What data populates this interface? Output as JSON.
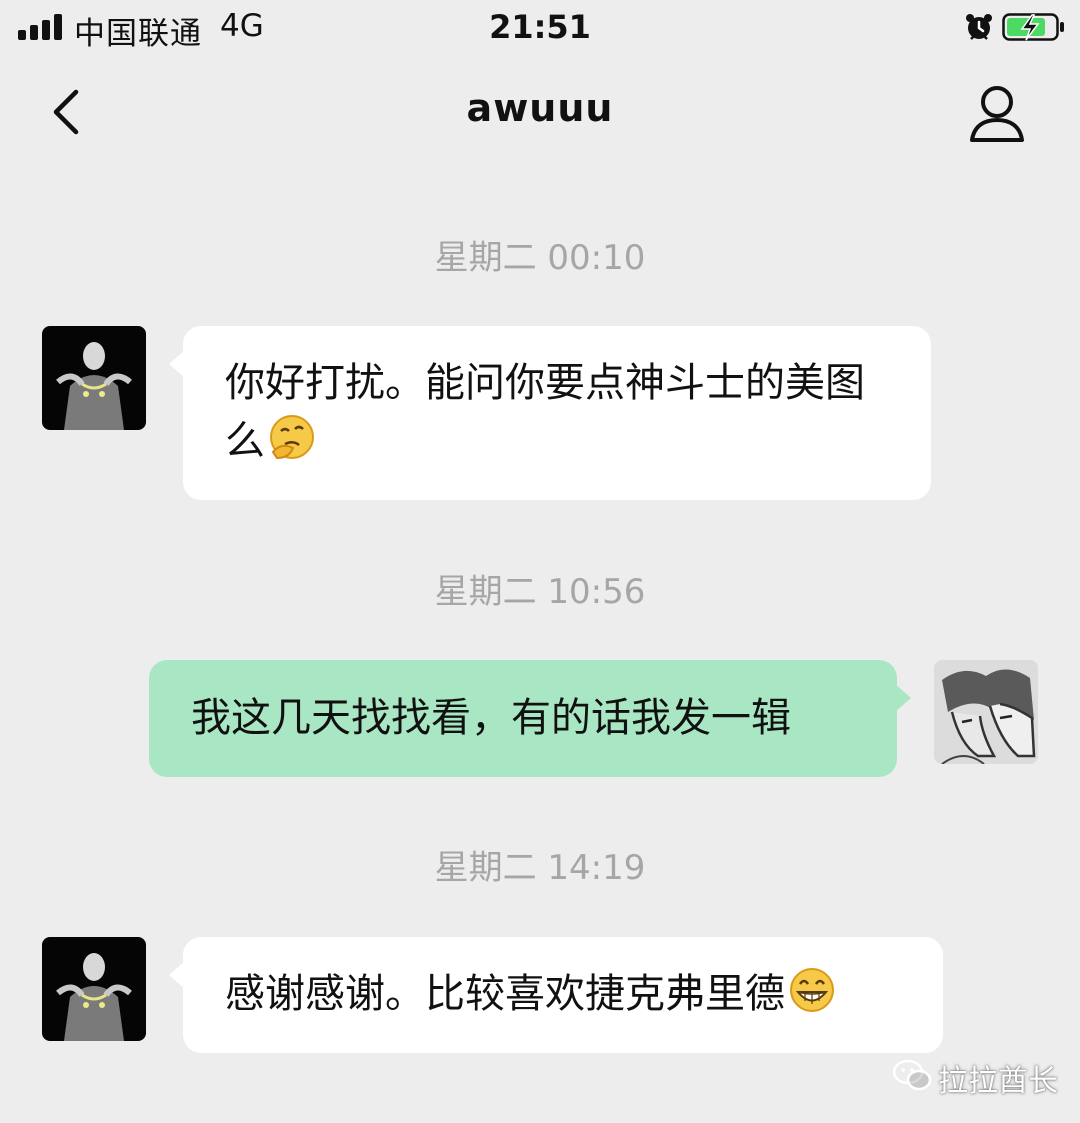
{
  "status_bar": {
    "carrier": "中国联通",
    "network": "4G",
    "time": "21:51"
  },
  "nav": {
    "title": "awuuu",
    "back_icon": "chevron-left-icon",
    "profile_icon": "person-icon"
  },
  "messages": [
    {
      "type": "timestamp",
      "text": "星期二 00:10"
    },
    {
      "type": "message",
      "direction": "in",
      "text": "你好打扰。能问你要点神斗士的美图么",
      "emoji": "thinking-face"
    },
    {
      "type": "timestamp",
      "text": "星期二 10:56"
    },
    {
      "type": "message",
      "direction": "out",
      "text": "我这几天找找看，有的话我发一辑"
    },
    {
      "type": "timestamp",
      "text": "星期二 14:19"
    },
    {
      "type": "message",
      "direction": "in",
      "text": "感谢感谢。比较喜欢捷克弗里德",
      "emoji": "grinning-face"
    }
  ],
  "watermark": {
    "text": "拉拉酋长"
  },
  "colors": {
    "background": "#ededed",
    "bubble_in": "#ffffff",
    "bubble_out": "#a9e7c4",
    "timestamp": "#a6a6a6",
    "battery": "#4cd964"
  }
}
